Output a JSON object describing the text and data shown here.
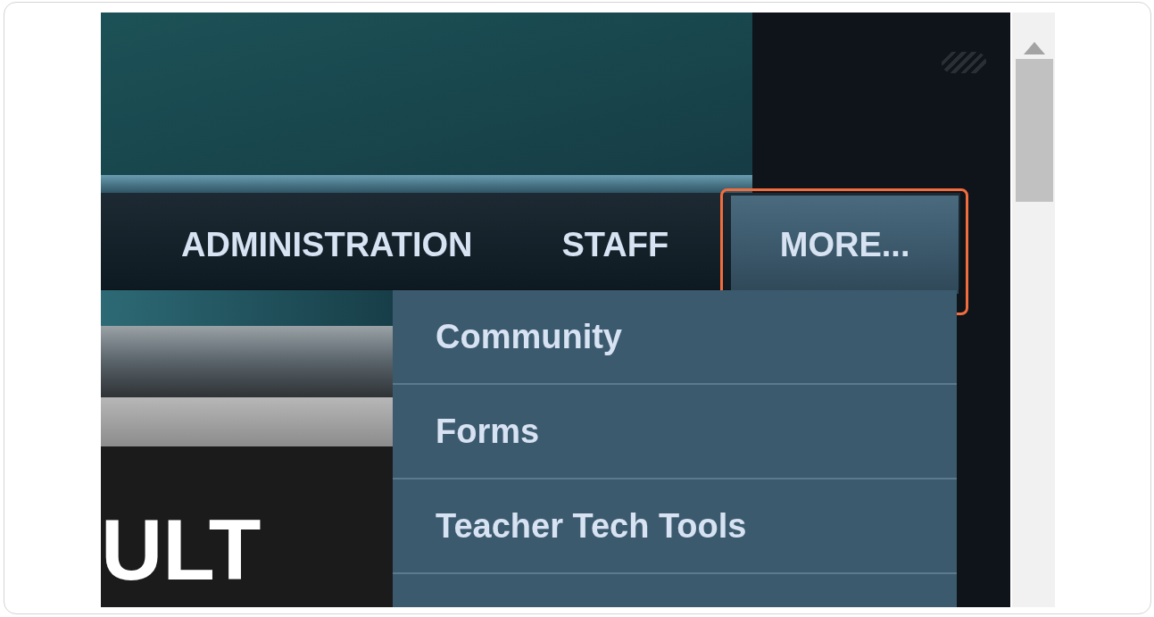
{
  "nav": {
    "items": [
      {
        "label": "ADMINISTRATION",
        "selected": false
      },
      {
        "label": "STAFF",
        "selected": false
      },
      {
        "label": "MORE...",
        "selected": true,
        "highlighted": true
      }
    ]
  },
  "dropdown": {
    "items": [
      {
        "label": "Community"
      },
      {
        "label": "Forms"
      },
      {
        "label": "Teacher Tech Tools"
      }
    ]
  },
  "banner": {
    "text": "ULT"
  }
}
